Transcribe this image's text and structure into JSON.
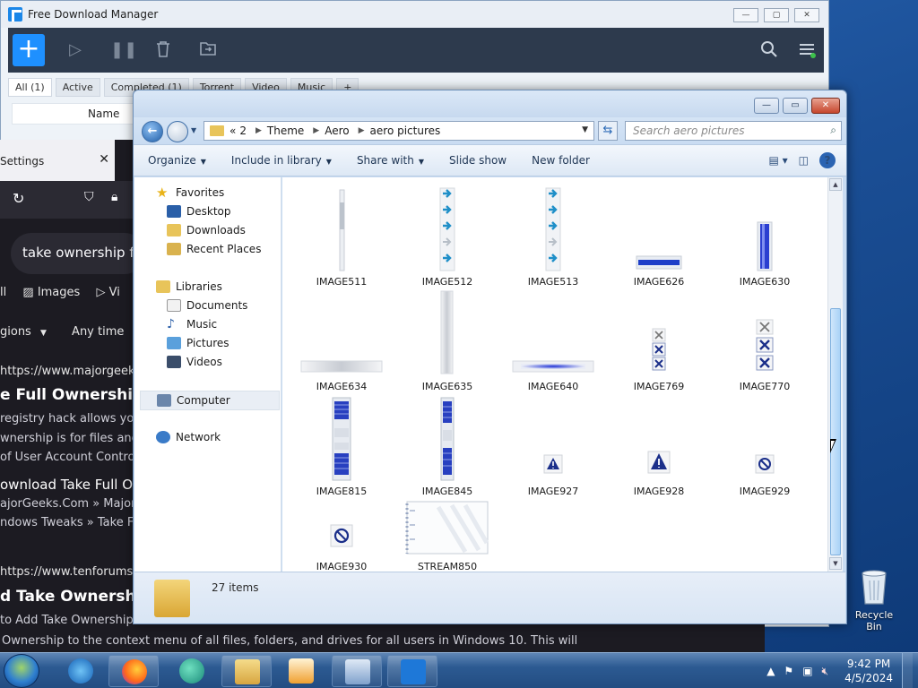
{
  "fdm": {
    "title": "Free Download Manager",
    "tabs": [
      "All (1)",
      "Active",
      "Completed (1)",
      "Torrent",
      "Video",
      "Music",
      "+"
    ],
    "column_name": "Name",
    "add_label": "+"
  },
  "browser": {
    "tab_title": "Settings",
    "search_query": "take ownership fu",
    "filter_images": "Images",
    "filter_video": "Vi",
    "filter_regions": "gions",
    "filter_time": "Any time",
    "all_tab": "ll",
    "result1_url": "https://www.majorgeeks",
    "result1_title": "e Full Ownershi",
    "result1_snip1": "registry hack allows you",
    "result1_snip2": "wnership is for files and",
    "result1_snip3": "of User Account Control",
    "result2_title": "ownload Take Full O",
    "result2_snip1": "ajorGeeks.Com » MajorG",
    "result2_snip2": "ndows Tweaks » Take F",
    "result3_url": "https://www.tenforums.c",
    "result3_title": "d Take Ownershi",
    "result3_snip1": "to Add Take Ownership",
    "bottom_snip": "Ownership to the context menu of all files, folders, and drives for all users in Windows 10. This will"
  },
  "explorer": {
    "breadcrumb": [
      "2",
      "Theme",
      "Aero",
      "aero pictures"
    ],
    "breadcrumb_prefix": "«",
    "search_placeholder": "Search aero pictures",
    "commands": [
      "Organize",
      "Include in library",
      "Share with",
      "Slide show",
      "New folder"
    ],
    "nav": {
      "favorites": "Favorites",
      "desktop": "Desktop",
      "downloads": "Downloads",
      "recent": "Recent Places",
      "libraries": "Libraries",
      "documents": "Documents",
      "music": "Music",
      "pictures": "Pictures",
      "videos": "Videos",
      "computer": "Computer",
      "network": "Network"
    },
    "files": [
      {
        "name": "IMAGE511"
      },
      {
        "name": "IMAGE512"
      },
      {
        "name": "IMAGE513"
      },
      {
        "name": "IMAGE626"
      },
      {
        "name": "IMAGE630"
      },
      {
        "name": "IMAGE634"
      },
      {
        "name": "IMAGE635"
      },
      {
        "name": "IMAGE640"
      },
      {
        "name": "IMAGE769"
      },
      {
        "name": "IMAGE770"
      },
      {
        "name": "IMAGE815"
      },
      {
        "name": "IMAGE845"
      },
      {
        "name": "IMAGE927"
      },
      {
        "name": "IMAGE928"
      },
      {
        "name": "IMAGE929"
      },
      {
        "name": "IMAGE930"
      },
      {
        "name": "STREAM850"
      }
    ],
    "item_count": "27 items"
  },
  "desktop": {
    "recycle_bin": "Recycle Bin"
  },
  "taskbar": {
    "time": "9:42 PM",
    "date": "4/5/2024"
  },
  "colors": {
    "accent_blue": "#1e90ff",
    "fdm_toolbar": "#2d3a4d",
    "browser_bg": "#1c1b22"
  }
}
